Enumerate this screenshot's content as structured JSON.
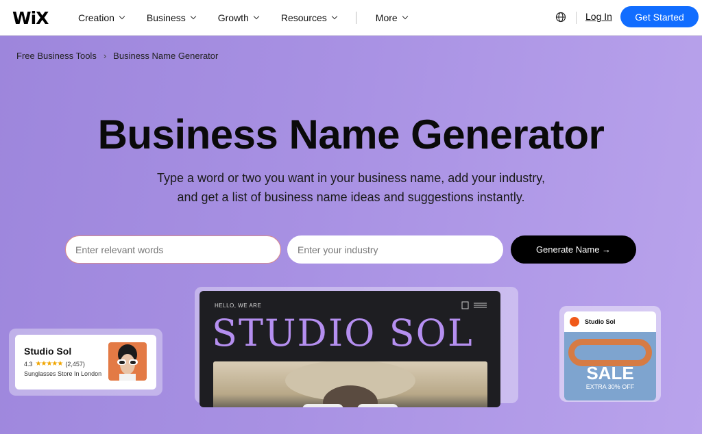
{
  "header": {
    "logo": "WiX",
    "nav": [
      "Creation",
      "Business",
      "Growth",
      "Resources"
    ],
    "more": "More",
    "login": "Log In",
    "cta": "Get Started"
  },
  "breadcrumb": {
    "parent": "Free Business Tools",
    "separator": "›",
    "current": "Business Name Generator"
  },
  "hero": {
    "title": "Business Name Generator",
    "subtitle_line1": "Type a word or two you want in your business name, add your industry,",
    "subtitle_line2": "and get a list of business name ideas and suggestions instantly.",
    "words_placeholder": "Enter relevant words",
    "industry_placeholder": "Enter your industry",
    "generate_label": "Generate Name →"
  },
  "store_card": {
    "title": "Studio Sol",
    "rating": "4.3",
    "stars": "★★★★★",
    "reviews": "(2,457)",
    "description": "Sunglasses Store In London"
  },
  "mockup": {
    "hello": "HELLO, WE ARE",
    "title": "STUDIO SOL"
  },
  "phone": {
    "name": "Studio Sol",
    "sale": "SALE",
    "sale_sub": "EXTRA 30% OFF"
  },
  "colors": {
    "accent": "#116dff",
    "hero_bg": "#a891e3",
    "mock_title": "#b58ff0"
  }
}
